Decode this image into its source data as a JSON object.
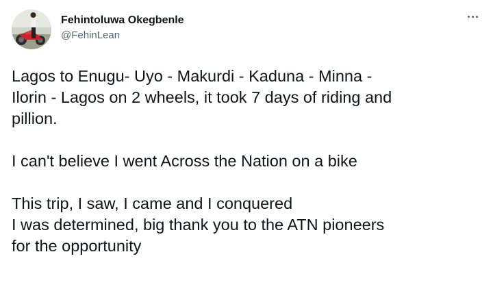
{
  "author": {
    "display_name": "Fehintoluwa Okegbenle",
    "handle": "@FehinLean",
    "avatar_icon": "profile-photo-motorbike"
  },
  "menu": {
    "icon": "more-options-icon"
  },
  "tweet": {
    "paragraphs": [
      {
        "lines": [
          "Lagos to Enugu- Uyo - Makurdi - Kaduna - Minna -",
          "Ilorin - Lagos on 2 wheels, it took 7 days of riding and",
          "pillion."
        ]
      },
      {
        "lines": [
          "I can't believe I went Across the Nation on a bike"
        ]
      },
      {
        "lines": [
          "This trip, I saw, I came and I conquered",
          "I was determined, big thank you to the ATN pioneers",
          "for the opportunity"
        ]
      }
    ]
  },
  "colors": {
    "text_primary": "#0f1419",
    "text_secondary": "#536471",
    "background": "#ffffff"
  }
}
